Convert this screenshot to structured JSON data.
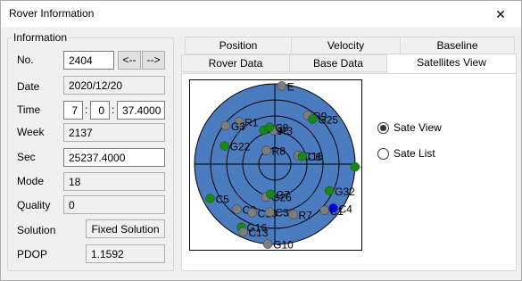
{
  "window": {
    "title": "Rover Information",
    "close_symbol": "✕"
  },
  "info": {
    "legend": "Information",
    "no_label": "No.",
    "no_value": "2404",
    "prev_label": "<--",
    "next_label": "-->",
    "date_label": "Date",
    "date_value": "2020/12/20",
    "time_label": "Time",
    "time_h": "7",
    "time_m": "0",
    "time_s": "37.4000",
    "time_sep": ":",
    "week_label": "Week",
    "week_value": "2137",
    "sec_label": "Sec",
    "sec_value": "25237.4000",
    "mode_label": "Mode",
    "mode_value": "18",
    "quality_label": "Quality",
    "quality_value": "0",
    "solution_label": "Solution",
    "solution_value": "Fixed Solution",
    "pdop_label": "PDOP",
    "pdop_value": "1.1592"
  },
  "tabs": {
    "row_back": [
      "Position",
      "Velocity",
      "Baseline"
    ],
    "row_front": [
      "Rover Data",
      "Base Data",
      "Satellites View"
    ],
    "active": "Satellites View"
  },
  "view_options": {
    "sate_view": "Sate View",
    "sate_list": "Sate List",
    "selected": "sate_view"
  },
  "sky": {
    "sphere_color": "#4b7cc0",
    "colors": {
      "green": "#138a13",
      "gray": "#7d7d7d",
      "blue": "#0000ff"
    },
    "satellites": [
      {
        "id": "E",
        "az": 5,
        "el": 2,
        "color": "gray"
      },
      {
        "id": "R9",
        "az": 34,
        "el": 24,
        "color": "gray"
      },
      {
        "id": "G25",
        "az": 40,
        "el": 24,
        "color": "green"
      },
      {
        "id": "R1",
        "az": 320,
        "el": 28,
        "color": "gray"
      },
      {
        "id": "G3",
        "az": 308,
        "el": 20,
        "color": "gray"
      },
      {
        "id": "C9",
        "az": 342,
        "el": 50,
        "color": "green"
      },
      {
        "id": "R3",
        "az": 358,
        "el": 52,
        "color": "gray"
      },
      {
        "id": "C8",
        "az": 352,
        "el": 48,
        "color": "green"
      },
      {
        "id": "G22",
        "az": 290,
        "el": 30,
        "color": "green"
      },
      {
        "id": "R8",
        "az": 328,
        "el": 72,
        "color": "gray"
      },
      {
        "id": "C16",
        "az": 70,
        "el": 62,
        "color": "gray"
      },
      {
        "id": "C6",
        "az": 74,
        "el": 58,
        "color": "green"
      },
      {
        "id": "C",
        "az": 92,
        "el": 0,
        "color": "green"
      },
      {
        "id": "G32",
        "az": 116,
        "el": 22,
        "color": "green"
      },
      {
        "id": "C4",
        "az": 127,
        "el": 8,
        "color": "blue"
      },
      {
        "id": "C1",
        "az": 133,
        "el": 14,
        "color": "gray"
      },
      {
        "id": "C5",
        "az": 242,
        "el": 8,
        "color": "green"
      },
      {
        "id": "C2",
        "az": 220,
        "el": 24,
        "color": "gray"
      },
      {
        "id": "G26",
        "az": 195,
        "el": 52,
        "color": "gray"
      },
      {
        "id": "C7",
        "az": 188,
        "el": 56,
        "color": "green"
      },
      {
        "id": "C10",
        "az": 205,
        "el": 30,
        "color": "gray"
      },
      {
        "id": "C3",
        "az": 186,
        "el": 36,
        "color": "gray"
      },
      {
        "id": "R7",
        "az": 160,
        "el": 30,
        "color": "gray"
      },
      {
        "id": "G16",
        "az": 208,
        "el": 10,
        "color": "green"
      },
      {
        "id": "C13",
        "az": 205,
        "el": 6,
        "color": "gray"
      },
      {
        "id": "G10",
        "az": 185,
        "el": 0,
        "color": "gray"
      }
    ]
  }
}
